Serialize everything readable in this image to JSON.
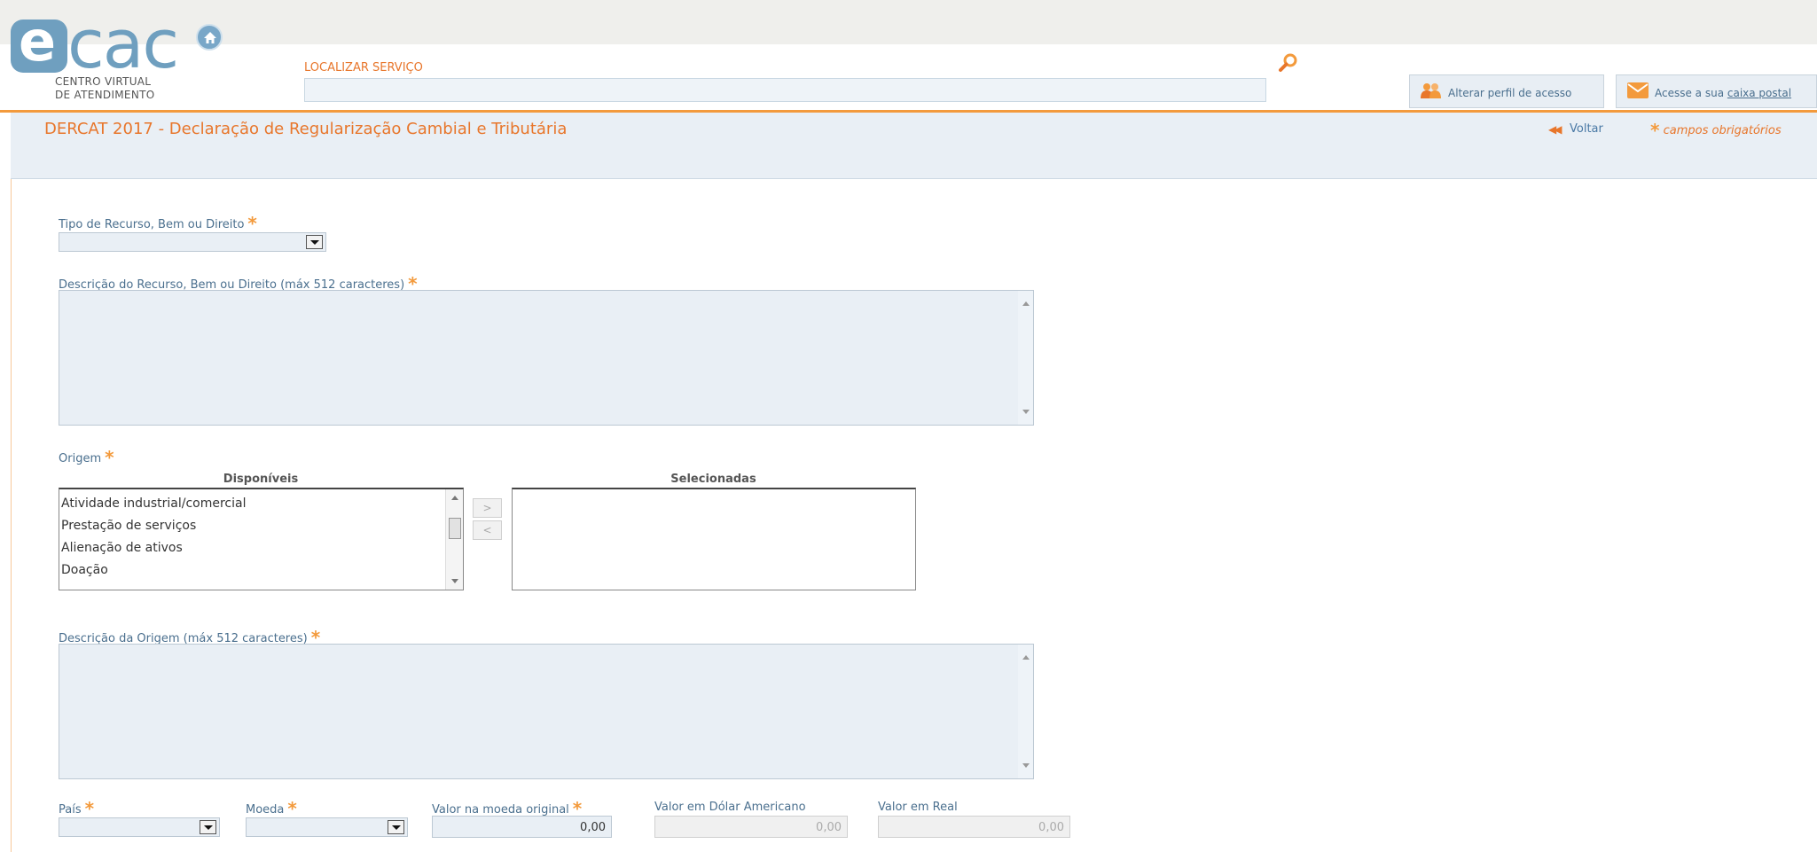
{
  "header": {
    "logo": {
      "letter": "e",
      "word": "cac",
      "subtitle_line1": "CENTRO VIRTUAL",
      "subtitle_line2": "DE ATENDIMENTO"
    },
    "search": {
      "label": "LOCALIZAR SERVIÇO",
      "value": ""
    },
    "perfil_button": "Alterar perfil de acesso",
    "caixa_button_prefix": "Acesse a sua ",
    "caixa_button_link": "caixa postal"
  },
  "title_bar": {
    "title": "DERCAT 2017 - Declaração de Regularização Cambial e Tributária",
    "voltar": "Voltar",
    "required_note": "campos obrigatórios"
  },
  "form": {
    "required_marker": "*",
    "tipo": {
      "label": "Tipo de Recurso, Bem ou Direito",
      "value": ""
    },
    "descricao": {
      "label": "Descrição do Recurso, Bem ou Direito (máx 512 caracteres)",
      "value": ""
    },
    "origem": {
      "label": "Origem",
      "disponiveis_header": "Disponíveis",
      "selecionadas_header": "Selecionadas",
      "disponiveis": [
        "Atividade industrial/comercial",
        "Prestação de serviços",
        "Alienação de ativos",
        "Doação"
      ],
      "selecionadas": [],
      "add_button": ">",
      "remove_button": "<"
    },
    "descricao_origem": {
      "label": "Descrição da Origem (máx 512 caracteres)",
      "value": ""
    },
    "pais": {
      "label": "País",
      "value": ""
    },
    "moeda": {
      "label": "Moeda",
      "value": ""
    },
    "valor_original": {
      "label": "Valor na moeda original",
      "value": "0,00"
    },
    "valor_dolar": {
      "label": "Valor em Dólar Americano",
      "value": "0,00"
    },
    "valor_real": {
      "label": "Valor em Real",
      "value": "0,00"
    }
  },
  "colors": {
    "accent": "#e8762b",
    "star": "#f39a3c",
    "link": "#4a79a5",
    "field_bg": "#e9eff5"
  },
  "icons": [
    "home-icon",
    "search-icon",
    "users-icon",
    "mail-icon",
    "double-chevron-left-icon"
  ]
}
